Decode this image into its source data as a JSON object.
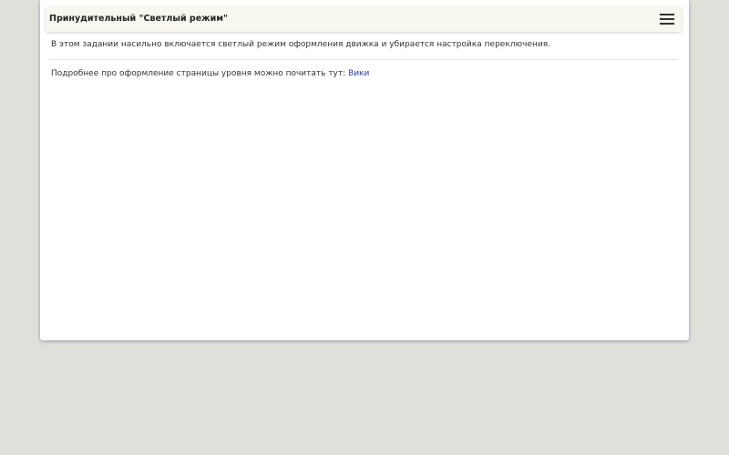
{
  "header": {
    "title": "Принудительный \"Светлый режим\"",
    "menu_icon": "hamburger-menu-icon"
  },
  "content": {
    "description": "В этом задании насильно включается светлый режим оформления движка и убирается настройка переключения.",
    "more_info_text": "Подробнее про оформление страницы уровня можно почитать тут:",
    "wiki_link_label": "Вики"
  },
  "colors": {
    "page_background": "#e0e0db",
    "panel_background": "#ffffff",
    "header_background": "#f7f7ef",
    "link": "#2a3a9c"
  }
}
